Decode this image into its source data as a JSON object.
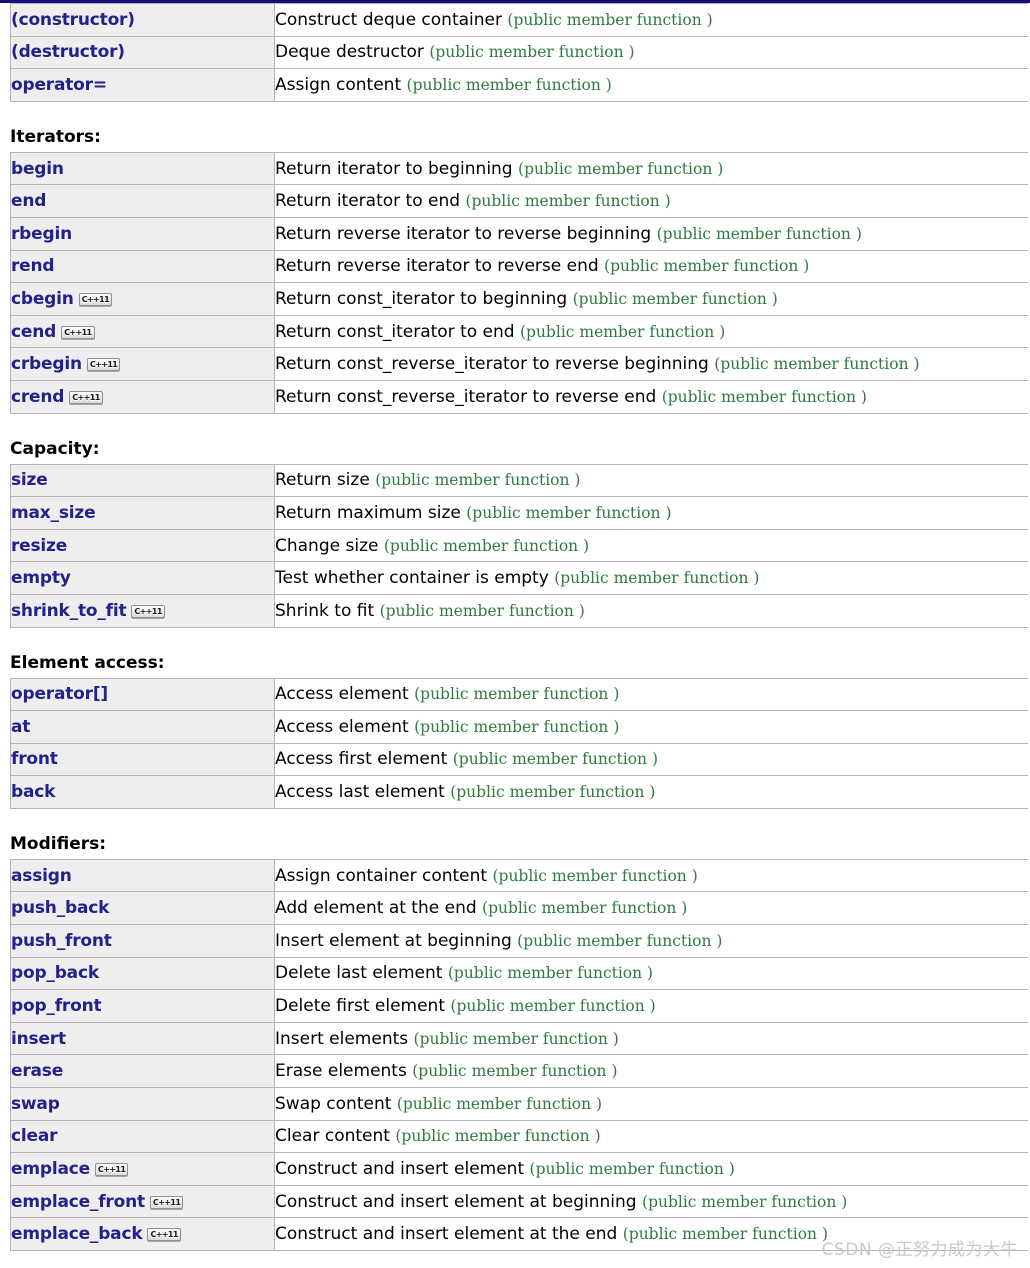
{
  "badge_label": "C++11",
  "kind_label": "(public member function )",
  "watermark": "CSDN @正努力成为大牛",
  "sections": [
    {
      "heading": "",
      "rows": [
        {
          "name": "(constructor)",
          "cpp11": false,
          "desc": "Construct deque container",
          "kind": "(public member function )"
        },
        {
          "name": "(destructor)",
          "cpp11": false,
          "desc": "Deque destructor",
          "kind": "(public member function )"
        },
        {
          "name": "operator=",
          "cpp11": false,
          "desc": "Assign content",
          "kind": "(public member function )"
        }
      ]
    },
    {
      "heading": "Iterators:",
      "rows": [
        {
          "name": "begin",
          "cpp11": false,
          "desc": "Return iterator to beginning",
          "kind": "(public member function )"
        },
        {
          "name": "end",
          "cpp11": false,
          "desc": "Return iterator to end",
          "kind": "(public member function )"
        },
        {
          "name": "rbegin",
          "cpp11": false,
          "desc": "Return reverse iterator to reverse beginning",
          "kind": "(public member function )"
        },
        {
          "name": "rend",
          "cpp11": false,
          "desc": "Return reverse iterator to reverse end",
          "kind": "(public member function )"
        },
        {
          "name": "cbegin",
          "cpp11": true,
          "desc": "Return const_iterator to beginning",
          "kind": "(public member function )"
        },
        {
          "name": "cend",
          "cpp11": true,
          "desc": "Return const_iterator to end",
          "kind": "(public member function )"
        },
        {
          "name": "crbegin",
          "cpp11": true,
          "desc": "Return const_reverse_iterator to reverse beginning",
          "kind": "(public member function )"
        },
        {
          "name": "crend",
          "cpp11": true,
          "desc": "Return const_reverse_iterator to reverse end",
          "kind": "(public member function )"
        }
      ]
    },
    {
      "heading": "Capacity:",
      "rows": [
        {
          "name": "size",
          "cpp11": false,
          "desc": "Return size",
          "kind": "(public member function )"
        },
        {
          "name": "max_size",
          "cpp11": false,
          "desc": "Return maximum size",
          "kind": "(public member function )"
        },
        {
          "name": "resize",
          "cpp11": false,
          "desc": "Change size",
          "kind": "(public member function )"
        },
        {
          "name": "empty",
          "cpp11": false,
          "desc": "Test whether container is empty",
          "kind": "(public member function )"
        },
        {
          "name": "shrink_to_fit",
          "cpp11": true,
          "desc": "Shrink to fit",
          "kind": "(public member function )"
        }
      ]
    },
    {
      "heading": "Element access:",
      "rows": [
        {
          "name": "operator[]",
          "cpp11": false,
          "desc": "Access element",
          "kind": "(public member function )"
        },
        {
          "name": "at",
          "cpp11": false,
          "desc": "Access element",
          "kind": "(public member function )"
        },
        {
          "name": "front",
          "cpp11": false,
          "desc": "Access first element",
          "kind": "(public member function )"
        },
        {
          "name": "back",
          "cpp11": false,
          "desc": "Access last element",
          "kind": "(public member function )"
        }
      ]
    },
    {
      "heading": "Modifiers:",
      "rows": [
        {
          "name": "assign",
          "cpp11": false,
          "desc": "Assign container content",
          "kind": "(public member function )"
        },
        {
          "name": "push_back",
          "cpp11": false,
          "desc": "Add element at the end",
          "kind": "(public member function )"
        },
        {
          "name": "push_front",
          "cpp11": false,
          "desc": "Insert element at beginning",
          "kind": "(public member function )"
        },
        {
          "name": "pop_back",
          "cpp11": false,
          "desc": "Delete last element",
          "kind": "(public member function )"
        },
        {
          "name": "pop_front",
          "cpp11": false,
          "desc": "Delete first element",
          "kind": "(public member function )"
        },
        {
          "name": "insert",
          "cpp11": false,
          "desc": "Insert elements",
          "kind": "(public member function )"
        },
        {
          "name": "erase",
          "cpp11": false,
          "desc": "Erase elements",
          "kind": "(public member function )"
        },
        {
          "name": "swap",
          "cpp11": false,
          "desc": "Swap content",
          "kind": "(public member function )"
        },
        {
          "name": "clear",
          "cpp11": false,
          "desc": "Clear content",
          "kind": "(public member function )"
        },
        {
          "name": "emplace",
          "cpp11": true,
          "desc": "Construct and insert element",
          "kind": "(public member function )"
        },
        {
          "name": "emplace_front",
          "cpp11": true,
          "desc": "Construct and insert element at beginning",
          "kind": "(public member function )"
        },
        {
          "name": "emplace_back",
          "cpp11": true,
          "desc": "Construct and insert element at the end",
          "kind": "(public member function )"
        }
      ]
    }
  ],
  "colors": {
    "top_rule": "#111177",
    "member_link": "#22228a",
    "kind_text": "#2f7a3f",
    "row_bg": "#eeeeee",
    "border": "#b4b4b4",
    "watermark": "#c9c9c9"
  }
}
